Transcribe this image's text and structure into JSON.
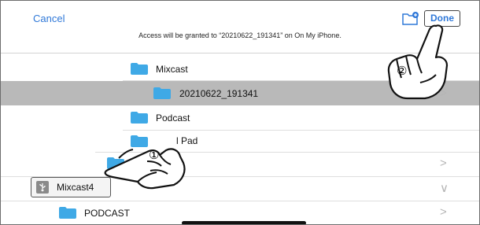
{
  "header": {
    "cancel_label": "Cancel",
    "done_label": "Done",
    "access_message": "Access will be granted to “20210622_191341” on On My iPhone."
  },
  "rows": [
    {
      "label": "Mixcast",
      "chevron": "∨"
    },
    {
      "label": "20210622_191341",
      "chevron": ">"
    },
    {
      "label": "Podcast"
    },
    {
      "label": "l Pad"
    },
    {
      "chevron": ">"
    },
    {
      "label": "Mixcast4",
      "chevron": "∨"
    },
    {
      "label": "PODCAST",
      "chevron": ">"
    }
  ],
  "callouts": {
    "step1": "①",
    "step2": "②"
  },
  "colors": {
    "accent": "#2f78d8",
    "folder": "#3fa9e6",
    "selected_row": "#b9b9b9"
  },
  "icons": [
    "new-folder-icon",
    "folder-icon",
    "usb-drive-icon",
    "pointing-hand-icon",
    "chevron-right-icon",
    "chevron-down-icon"
  ]
}
